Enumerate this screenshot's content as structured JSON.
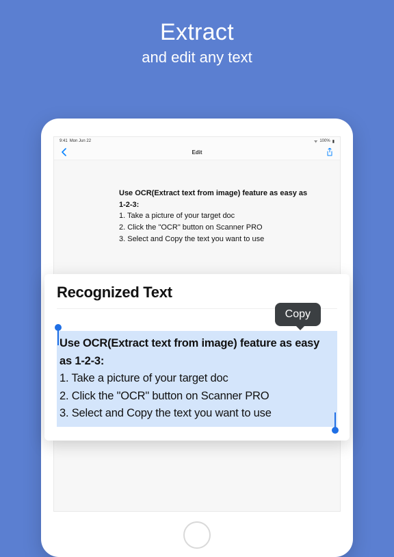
{
  "hero": {
    "title": "Extract",
    "subtitle": "and edit any text"
  },
  "statusbar": {
    "time": "9:41",
    "date": "Mon Jun 22",
    "wifi": "100%"
  },
  "nav": {
    "title": "Edit"
  },
  "original": {
    "bold": "Use OCR(Extract text from image) feature as easy as 1-2-3:",
    "line1": "1. Take a picture of your target doc",
    "line2": "2. Click the \"OCR\" button on Scanner PRO",
    "line3": "3. Select and Copy the text you want to use"
  },
  "panel": {
    "heading": "Recognized Text",
    "copy_label": "Copy",
    "bold": "Use OCR(Extract text from image) feature as easy as 1-2-3:",
    "line1": "1. Take a picture of your target doc",
    "line2": "2. Click the \"OCR\" button on Scanner PRO",
    "line3": "3. Select and Copy the text you want to use"
  }
}
